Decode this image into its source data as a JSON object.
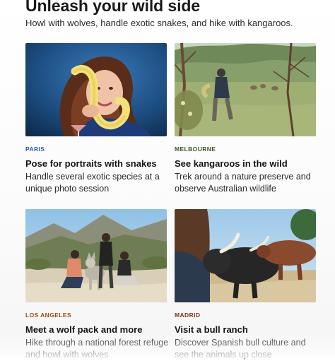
{
  "header": {
    "title": "Unleash your wild side",
    "subtitle": "Howl with wolves, handle exotic snakes, and hike with kangaroos."
  },
  "cards": [
    {
      "city": "PARIS",
      "city_color": "#2a5da8",
      "title": "Pose for portraits with snakes",
      "description": "Handle several exotic species at a unique photo session"
    },
    {
      "city": "MELBOURNE",
      "city_color": "#3f5a24",
      "title": "See kangaroos in the wild",
      "description": "Trek around a nature preserve and observe Australian wildlife"
    },
    {
      "city": "LOS ANGELES",
      "city_color": "#9a4a1c",
      "title": "Meet a wolf pack and more",
      "description": "Hike through a national forest refuge and howl with wolves"
    },
    {
      "city": "MADRID",
      "city_color": "#7a3a1a",
      "title": "Visit a bull ranch",
      "description": "Discover Spanish bull culture and see the animals up close"
    }
  ]
}
